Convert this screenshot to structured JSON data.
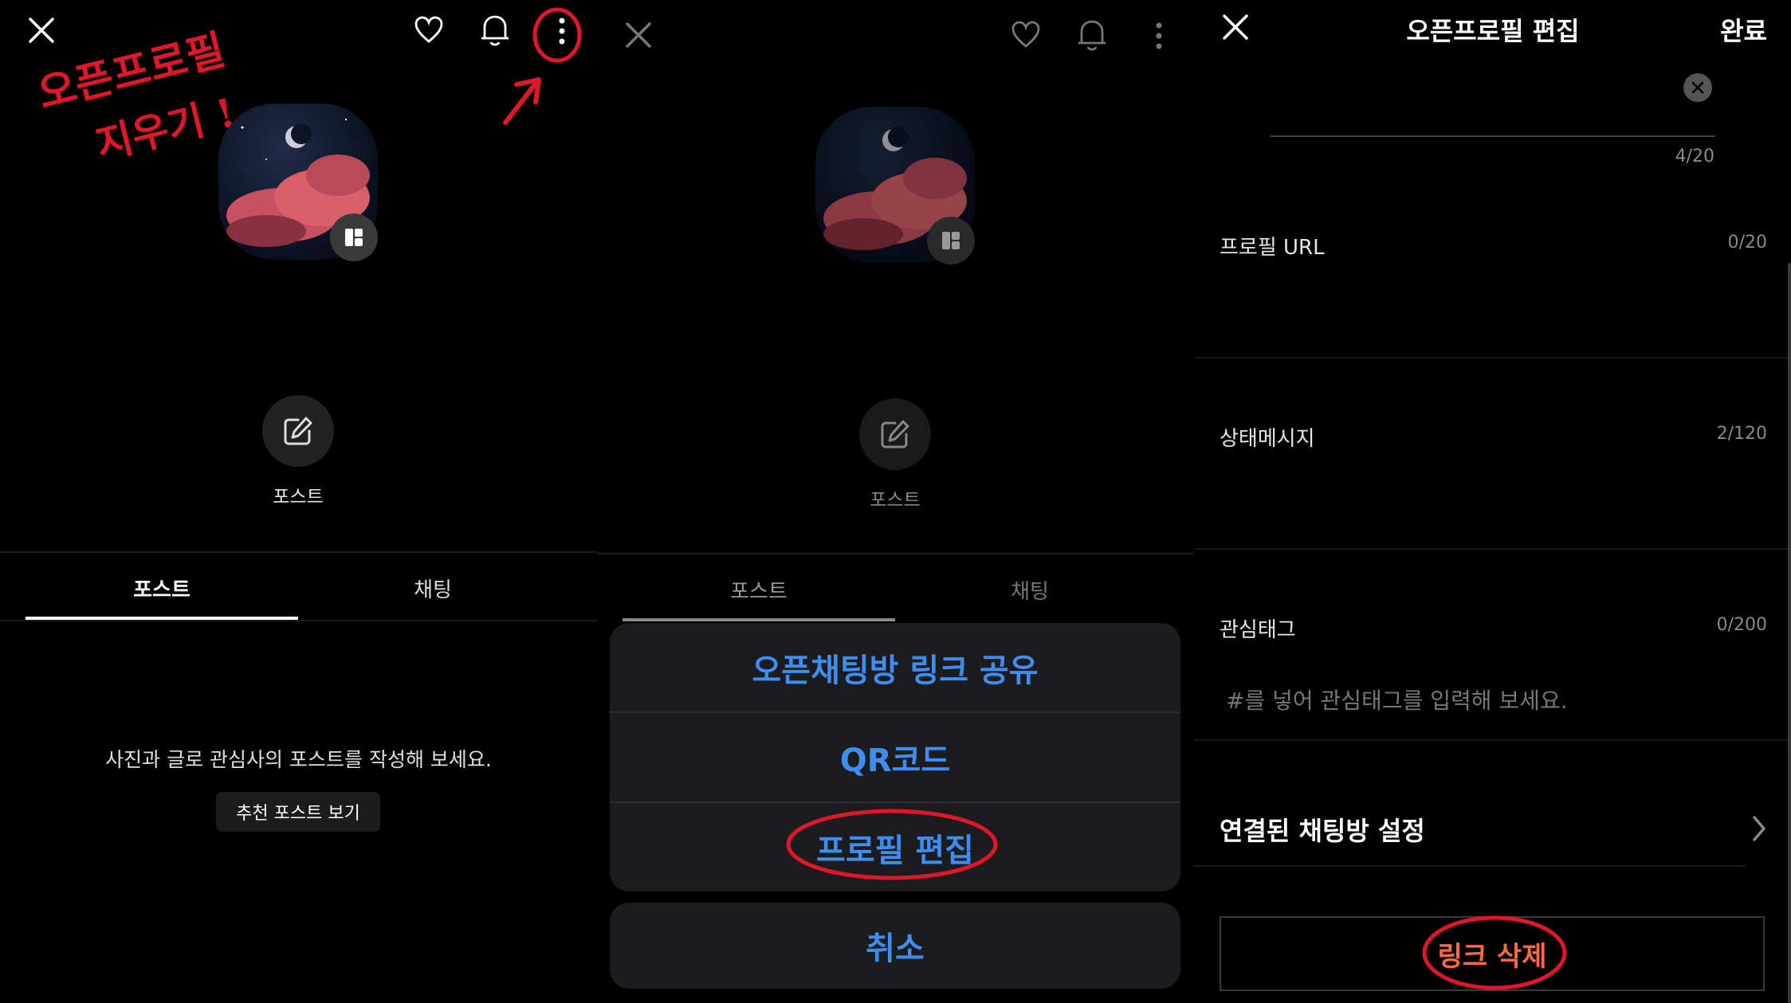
{
  "panel1": {
    "annotation_line1": "오픈프로필",
    "annotation_line2": "지우기 !",
    "post_button_label": "포스트",
    "tabs": [
      {
        "label": "포스트"
      },
      {
        "label": "채팅"
      }
    ],
    "empty_message": "사진과 글로 관심사의 포스트를 작성해 보세요.",
    "recommend_button": "추천 포스트 보기"
  },
  "panel2": {
    "post_button_label": "포스트",
    "tabs": [
      {
        "label": "포스트"
      },
      {
        "label": "채팅"
      }
    ],
    "sheet_items": [
      {
        "label": "오픈채팅방 링크 공유"
      },
      {
        "label": "QR코드"
      },
      {
        "label": "프로필 편집"
      }
    ],
    "cancel_label": "취소"
  },
  "panel3": {
    "title": "오픈프로필 편집",
    "done": "완료",
    "name_count": "4/20",
    "url_label": "프로필 URL",
    "url_count": "0/20",
    "status_label": "상태메시지",
    "status_count": "2/120",
    "tag_label": "관심태그",
    "tag_count": "0/200",
    "tag_placeholder": "#를 넣어 관심태그를 입력해 보세요.",
    "linked_settings": "연결된 채팅방 설정",
    "delete_link": "링크 삭제"
  },
  "colors": {
    "accent_blue": "#3d8ef0",
    "annotation_red": "#e0162b",
    "delete_orange": "#ff6a3d"
  },
  "icons": [
    "close-icon",
    "heart-icon",
    "bell-icon",
    "more-vertical-icon",
    "edit-icon",
    "layout-icon",
    "chevron-right-icon",
    "clear-icon"
  ]
}
